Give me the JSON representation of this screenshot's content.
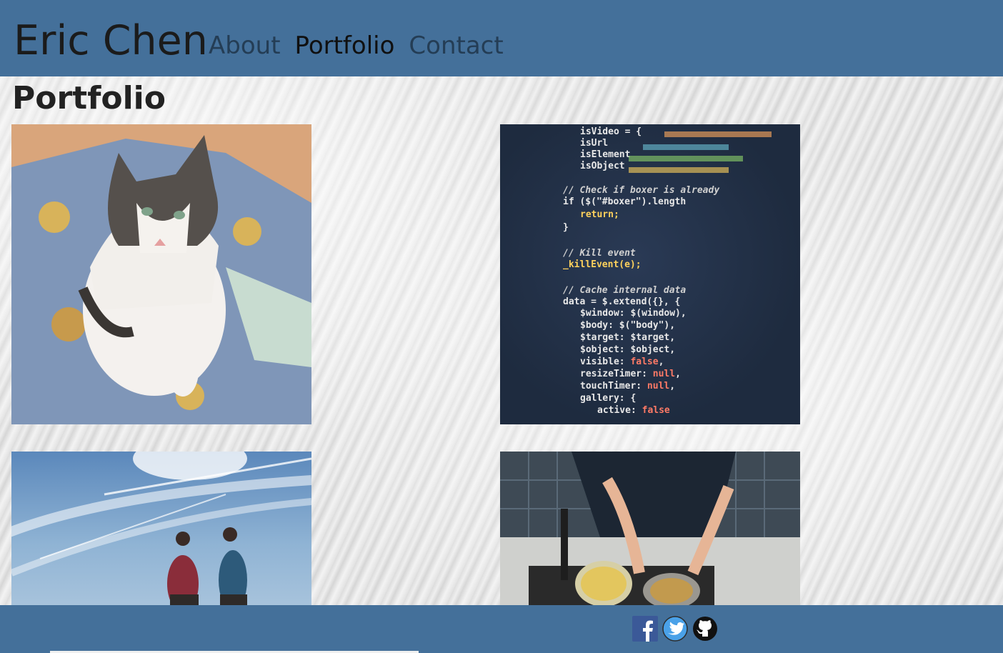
{
  "header": {
    "brand": "Eric Chen",
    "nav": [
      {
        "label": "About",
        "active": false
      },
      {
        "label": "Portfolio",
        "active": true
      },
      {
        "label": "Contact",
        "active": false
      }
    ],
    "background": "#44709a"
  },
  "main": {
    "title": "Portfolio",
    "projects": [
      {
        "image": "cat-on-blanket-photo"
      },
      {
        "image": "code-screen-photo"
      },
      {
        "image": "hikers-sky-photo"
      },
      {
        "image": "chef-cooking-photo"
      }
    ]
  },
  "footer": {
    "background": "#44709a",
    "social": [
      {
        "icon": "facebook-icon"
      },
      {
        "icon": "twitter-icon"
      },
      {
        "icon": "github-icon"
      }
    ]
  }
}
